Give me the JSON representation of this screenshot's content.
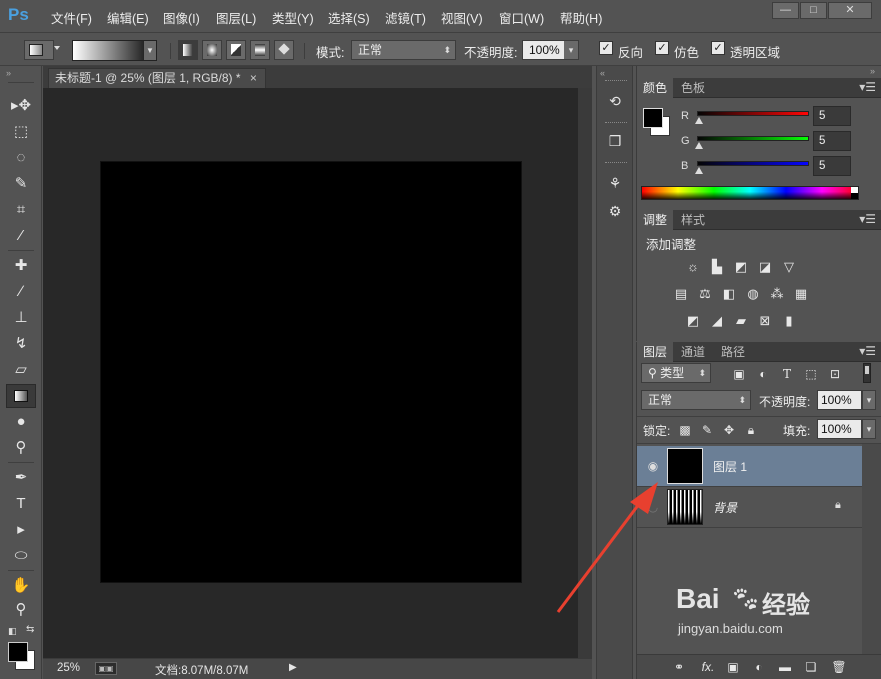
{
  "app": {
    "logo": "Ps",
    "menu": [
      "文件(F)",
      "编辑(E)",
      "图像(I)",
      "图层(L)",
      "类型(Y)",
      "选择(S)",
      "滤镜(T)",
      "视图(V)",
      "窗口(W)",
      "帮助(H)"
    ],
    "window_controls": {
      "minimize": "—",
      "maximize": "□",
      "close": "✕"
    }
  },
  "options_bar": {
    "mode_label": "模式:",
    "mode_value": "正常",
    "opacity_label": "不透明度:",
    "opacity_value": "100%",
    "checkboxes": [
      {
        "label": "反向",
        "checked": true
      },
      {
        "label": "仿色",
        "checked": true
      },
      {
        "label": "透明区域",
        "checked": true
      }
    ]
  },
  "document": {
    "tab_title": "未标题-1 @ 25% (图层 1, RGB/8) *",
    "tab_close": "×",
    "zoom": "25%",
    "doc_info": "文档:8.07M/8.07M"
  },
  "color_panel": {
    "tabs": [
      "颜色",
      "色板"
    ],
    "channels": [
      {
        "label": "R",
        "value": "5",
        "color": "#ff0000"
      },
      {
        "label": "G",
        "value": "5",
        "color": "#00ff00"
      },
      {
        "label": "B",
        "value": "5",
        "color": "#0000ff"
      }
    ]
  },
  "adjust_panel": {
    "tabs": [
      "调整",
      "样式"
    ],
    "title": "添加调整",
    "rows": [
      [
        "brightness-icon",
        "levels-icon",
        "curves-icon",
        "exposure-icon",
        "vibrance-icon"
      ],
      [
        "hue-icon",
        "color-balance-icon",
        "bw-icon",
        "photo-filter-icon",
        "channel-mixer-icon",
        "color-lookup-icon"
      ],
      [
        "invert-icon",
        "posterize-icon",
        "threshold-icon",
        "selective-color-icon",
        "gradient-map-icon"
      ]
    ]
  },
  "layers_panel": {
    "tabs": [
      "图层",
      "通道",
      "路径"
    ],
    "filter_kind": "类型",
    "blend_mode": "正常",
    "opacity_label": "不透明度:",
    "opacity_value": "100%",
    "lock_label": "锁定:",
    "fill_label": "填充:",
    "fill_value": "100%",
    "layers": [
      {
        "name": "图层 1",
        "selected": true,
        "visible": true
      },
      {
        "name": "背景",
        "selected": false,
        "visible": false,
        "locked": true
      }
    ],
    "bottom_icons": [
      "link-icon",
      "fx-icon",
      "mask-icon",
      "adjustment-layer-icon",
      "group-icon",
      "new-layer-icon",
      "trash-icon"
    ],
    "fx_label": "fx."
  },
  "watermark": {
    "brand": "Bai",
    "brand2": "经验",
    "url": "jingyan.baidu.com"
  },
  "colors": {
    "accent_arrow": "#e8402f",
    "selected_layer": "#6b7f96"
  }
}
